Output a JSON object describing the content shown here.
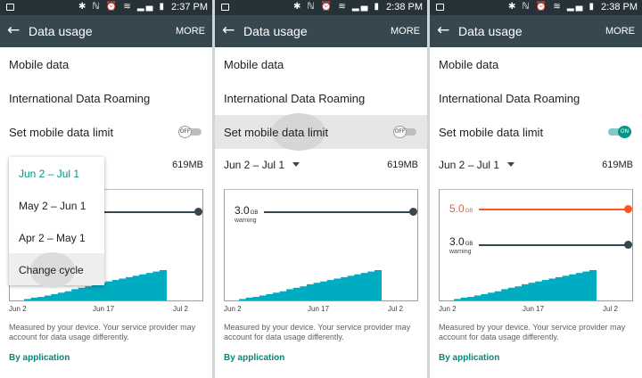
{
  "status": {
    "icons": "✱ ℕ ⏰ ≋ ▂▄ ▮",
    "panels": [
      {
        "time": "2:37 PM"
      },
      {
        "time": "2:38 PM"
      },
      {
        "time": "2:38 PM"
      }
    ]
  },
  "appbar": {
    "title": "Data usage",
    "more": "MORE",
    "back_icon": "arrow-left-icon"
  },
  "settings": {
    "mobile_data": "Mobile data",
    "roaming": "International Data Roaming",
    "limit": "Set mobile data limit"
  },
  "toggle": {
    "off": "OFF",
    "on": "ON"
  },
  "cycle": {
    "current": "Jun 2 – Jul 1",
    "total": "619MB",
    "options": [
      "Jun 2 – Jul 1",
      "May 2 – Jun 1",
      "Apr 2 – May 1",
      "Change cycle"
    ]
  },
  "limits": {
    "warning_value": "3.0",
    "limit_value": "5.0",
    "unit": "GB",
    "warning_label": "warning",
    "warning_color": "#37474f",
    "limit_color": "#ff5722"
  },
  "chart_data": {
    "type": "area",
    "x_ticks": [
      "Jun 2",
      "Jun 17",
      "Jul 2"
    ],
    "usage_fraction_by_day": [
      0.02,
      0.04,
      0.05,
      0.07,
      0.09,
      0.11,
      0.13,
      0.16,
      0.18,
      0.2,
      0.23,
      0.25,
      0.27,
      0.29,
      0.31,
      0.33,
      0.35,
      0.37,
      0.39,
      0.41,
      0.43
    ],
    "bar_color": "#00acc1"
  },
  "note": "Measured by your device. Your service provider may account for data usage differently.",
  "by_application": "By application"
}
